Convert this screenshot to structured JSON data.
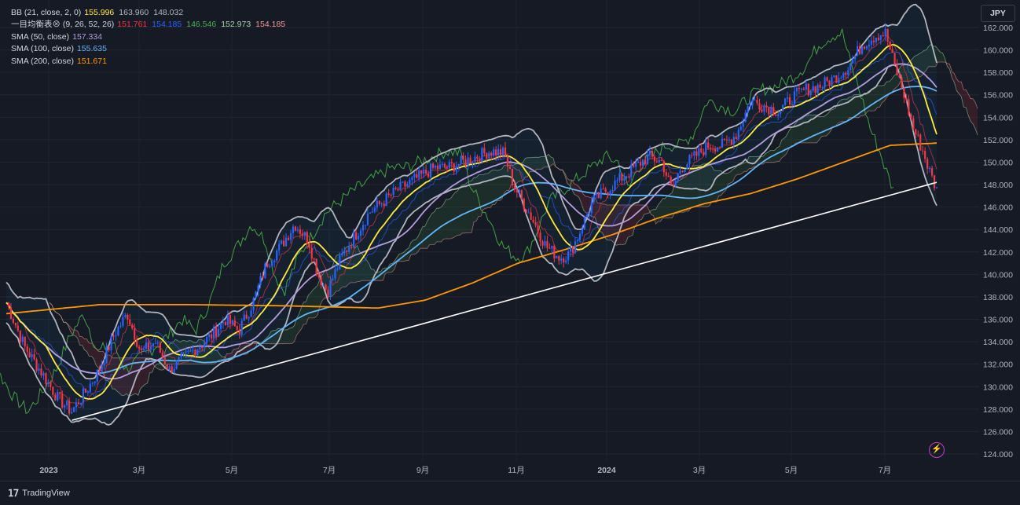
{
  "chart_data": {
    "type": "line",
    "currency": "JPY",
    "y_range": [
      124,
      163
    ],
    "y_ticks": [
      "162.000",
      "160.000",
      "158.000",
      "156.000",
      "154.000",
      "152.000",
      "150.000",
      "148.000",
      "146.000",
      "144.000",
      "142.000",
      "140.000",
      "138.000",
      "136.000",
      "134.000",
      "132.000",
      "130.000",
      "128.000",
      "126.000",
      "124.000"
    ],
    "x_labels": [
      "2023",
      "3月",
      "5月",
      "7月",
      "9月",
      "11月",
      "2024",
      "3月",
      "5月",
      "7月"
    ],
    "legend": [
      {
        "name": "BB (21, close, 2, 0)",
        "values": [
          {
            "v": "155.996",
            "c": "#ffeb3b"
          },
          {
            "v": "163.960",
            "c": "#b2b5be"
          },
          {
            "v": "148.032",
            "c": "#b2b5be"
          }
        ]
      },
      {
        "name": "一目均衡表⊗ (9, 26, 52, 26)",
        "values": [
          {
            "v": "151.761",
            "c": "#f23645"
          },
          {
            "v": "154.185",
            "c": "#2962ff"
          },
          {
            "v": "146.546",
            "c": "#4caf50"
          },
          {
            "v": "152.973",
            "c": "#a5d6a7"
          },
          {
            "v": "154.185",
            "c": "#ef9a9a"
          }
        ]
      },
      {
        "name": "SMA (50, close)",
        "values": [
          {
            "v": "157.334",
            "c": "#b39ddb"
          }
        ]
      },
      {
        "name": "SMA (100, close)",
        "values": [
          {
            "v": "155.635",
            "c": "#64b5f6"
          }
        ]
      },
      {
        "name": "SMA (200, close)",
        "values": [
          {
            "v": "151.671",
            "c": "#ff9800"
          }
        ]
      }
    ],
    "price_key": [
      [
        0,
        137.5
      ],
      [
        0.02,
        133.5
      ],
      [
        0.04,
        131.0
      ],
      [
        0.055,
        129.0
      ],
      [
        0.07,
        127.8
      ],
      [
        0.085,
        129.5
      ],
      [
        0.1,
        131.5
      ],
      [
        0.115,
        134.5
      ],
      [
        0.13,
        136.5
      ],
      [
        0.145,
        133.0
      ],
      [
        0.16,
        134.0
      ],
      [
        0.175,
        131.5
      ],
      [
        0.19,
        132.5
      ],
      [
        0.205,
        133.5
      ],
      [
        0.22,
        134.5
      ],
      [
        0.235,
        136.0
      ],
      [
        0.25,
        135.0
      ],
      [
        0.265,
        137.5
      ],
      [
        0.28,
        141.0
      ],
      [
        0.295,
        142.5
      ],
      [
        0.31,
        144.5
      ],
      [
        0.325,
        143.0
      ],
      [
        0.335,
        140.0
      ],
      [
        0.345,
        138.5
      ],
      [
        0.36,
        141.5
      ],
      [
        0.375,
        143.5
      ],
      [
        0.39,
        145.5
      ],
      [
        0.405,
        146.5
      ],
      [
        0.42,
        147.5
      ],
      [
        0.44,
        148.5
      ],
      [
        0.46,
        149.5
      ],
      [
        0.475,
        149.5
      ],
      [
        0.49,
        150.0
      ],
      [
        0.505,
        150.5
      ],
      [
        0.52,
        151.0
      ],
      [
        0.535,
        150.8
      ],
      [
        0.545,
        148.0
      ],
      [
        0.555,
        146.5
      ],
      [
        0.565,
        145.0
      ],
      [
        0.58,
        142.5
      ],
      [
        0.595,
        141.5
      ],
      [
        0.605,
        141.8
      ],
      [
        0.615,
        143.5
      ],
      [
        0.63,
        146.5
      ],
      [
        0.645,
        147.5
      ],
      [
        0.66,
        148.5
      ],
      [
        0.675,
        149.5
      ],
      [
        0.69,
        150.5
      ],
      [
        0.705,
        150.0
      ],
      [
        0.715,
        147.5
      ],
      [
        0.725,
        149.5
      ],
      [
        0.74,
        150.5
      ],
      [
        0.755,
        151.5
      ],
      [
        0.77,
        151.5
      ],
      [
        0.785,
        152.5
      ],
      [
        0.8,
        155.5
      ],
      [
        0.815,
        155.0
      ],
      [
        0.83,
        154.5
      ],
      [
        0.845,
        155.8
      ],
      [
        0.86,
        156.5
      ],
      [
        0.875,
        156.8
      ],
      [
        0.89,
        157.5
      ],
      [
        0.905,
        158.5
      ],
      [
        0.92,
        160.5
      ],
      [
        0.935,
        161.3
      ],
      [
        0.945,
        161.5
      ],
      [
        0.955,
        158.5
      ],
      [
        0.965,
        156.0
      ],
      [
        0.975,
        153.0
      ],
      [
        0.985,
        151.0
      ],
      [
        0.993,
        149.0
      ],
      [
        1.0,
        147.5
      ]
    ],
    "sma_200_key": [
      [
        0,
        136.5
      ],
      [
        0.1,
        137.3
      ],
      [
        0.2,
        137.3
      ],
      [
        0.3,
        137.2
      ],
      [
        0.35,
        137.1
      ],
      [
        0.4,
        137.0
      ],
      [
        0.45,
        137.7
      ],
      [
        0.5,
        139.2
      ],
      [
        0.55,
        141.0
      ],
      [
        0.6,
        142.2
      ],
      [
        0.65,
        143.5
      ],
      [
        0.7,
        145.0
      ],
      [
        0.75,
        146.3
      ],
      [
        0.8,
        147.2
      ],
      [
        0.85,
        148.5
      ],
      [
        0.9,
        150.0
      ],
      [
        0.95,
        151.5
      ],
      [
        1.0,
        151.7
      ]
    ],
    "trendline": {
      "start": [
        0.02,
        127.0
      ],
      "end": [
        1.0,
        148.2
      ]
    }
  }
}
